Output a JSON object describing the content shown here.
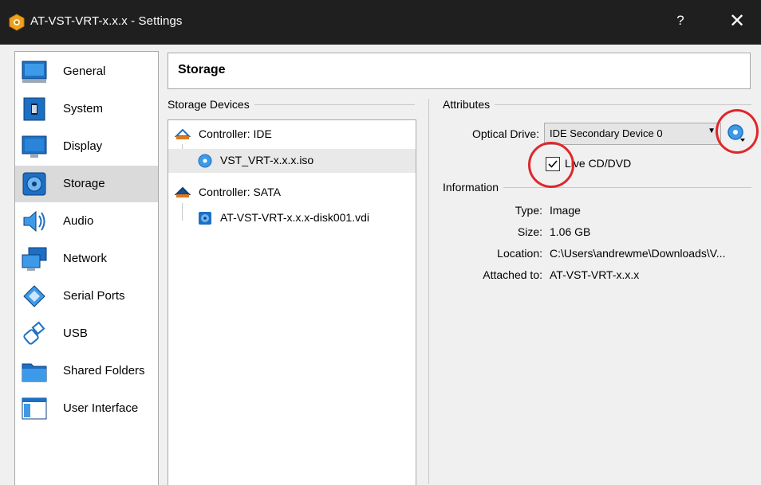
{
  "window": {
    "title": "AT-VST-VRT-x.x.x - Settings",
    "help_label": "?",
    "close_label": "✕"
  },
  "sidebar": {
    "items": [
      {
        "label": "General",
        "icon": "general-icon",
        "selected": false
      },
      {
        "label": "System",
        "icon": "system-icon",
        "selected": false
      },
      {
        "label": "Display",
        "icon": "display-icon",
        "selected": false
      },
      {
        "label": "Storage",
        "icon": "storage-icon",
        "selected": true
      },
      {
        "label": "Audio",
        "icon": "audio-icon",
        "selected": false
      },
      {
        "label": "Network",
        "icon": "network-icon",
        "selected": false
      },
      {
        "label": "Serial Ports",
        "icon": "serial-ports-icon",
        "selected": false
      },
      {
        "label": "USB",
        "icon": "usb-icon",
        "selected": false
      },
      {
        "label": "Shared Folders",
        "icon": "shared-folders-icon",
        "selected": false
      },
      {
        "label": "User Interface",
        "icon": "user-interface-icon",
        "selected": false
      }
    ]
  },
  "page": {
    "title": "Storage"
  },
  "storage_devices": {
    "title": "Storage Devices",
    "tree": [
      {
        "label": "Controller: IDE",
        "level": 0,
        "icon": "ide-controller-icon"
      },
      {
        "label": "VST_VRT-x.x.x.iso",
        "level": 1,
        "icon": "optical-disc-icon",
        "selected": true
      },
      {
        "label": "Controller: SATA",
        "level": 0,
        "icon": "sata-controller-icon"
      },
      {
        "label": "AT-VST-VRT-x.x.x-disk001.vdi",
        "level": 1,
        "icon": "hard-disk-icon"
      }
    ]
  },
  "attributes": {
    "title": "Attributes",
    "optical_drive_label": "Optical Drive:",
    "optical_drive_value": "IDE Secondary Device 0",
    "live_cd_label": "Live CD/DVD",
    "live_cd_checked": true
  },
  "information": {
    "title": "Information",
    "rows": [
      {
        "label": "Type:",
        "value": "Image"
      },
      {
        "label": "Size:",
        "value": "1.06 GB"
      },
      {
        "label": "Location:",
        "value": "C:\\Users\\andrewme\\Downloads\\V..."
      },
      {
        "label": "Attached to:",
        "value": "AT-VST-VRT-x.x.x"
      }
    ]
  },
  "colors": {
    "titlebar": "#1f1f1f",
    "highlight_circle": "#e0262b",
    "accent_blue": "#1e73be"
  }
}
